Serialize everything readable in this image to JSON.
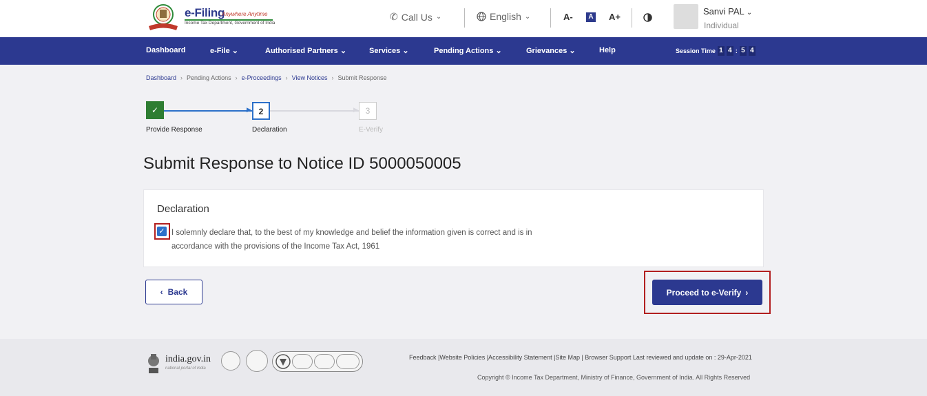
{
  "header": {
    "brand": "e-Filing",
    "tagline": "Anywhere Anytime",
    "dept": "Income Tax Department, Government of India",
    "call_us": "Call Us",
    "language": "English",
    "font_decrease": "A-",
    "font_normal": "A",
    "font_increase": "A+",
    "user_name": "Sanvi PAL",
    "user_role": "Individual"
  },
  "nav": {
    "items": [
      {
        "label": "Dashboard"
      },
      {
        "label": "e-File"
      },
      {
        "label": "Authorised Partners"
      },
      {
        "label": "Services"
      },
      {
        "label": "Pending Actions"
      },
      {
        "label": "Grievances"
      },
      {
        "label": "Help"
      }
    ],
    "session_label": "Session Time",
    "session_digits": [
      "1",
      "4",
      "5",
      "4"
    ]
  },
  "breadcrumb": [
    "Dashboard",
    "Pending Actions",
    "e-Proceedings",
    "View Notices",
    "Submit Response"
  ],
  "stepper": {
    "steps": [
      {
        "number": "1",
        "label": "Provide Response",
        "state": "done"
      },
      {
        "number": "2",
        "label": "Declaration",
        "state": "active"
      },
      {
        "number": "3",
        "label": "E-Verify",
        "state": "inactive"
      }
    ]
  },
  "page_title": "Submit Response to Notice ID 5000050005",
  "declaration": {
    "title": "Declaration",
    "checked": true,
    "text": "I solemnly declare that, to the best of my knowledge and belief the information given is correct and is in accordance with the provisions of the Income Tax Act, 1961"
  },
  "buttons": {
    "back": "Back",
    "proceed": "Proceed to e-Verify"
  },
  "footer": {
    "india_gov": "india.gov.in",
    "india_gov_sub": "national portal of india",
    "links": "Feedback |Website Policies |Accessibility Statement |Site Map | Browser Support  Last reviewed and update on : 29-Apr-2021",
    "copyright": "Copyright © Income Tax Department, Ministry of Finance, Government of India. All Rights Reserved"
  },
  "colors": {
    "primary": "#2c3990",
    "success": "#2e7d32",
    "highlight": "#b21f1f",
    "checkbox": "#2c70c9"
  }
}
